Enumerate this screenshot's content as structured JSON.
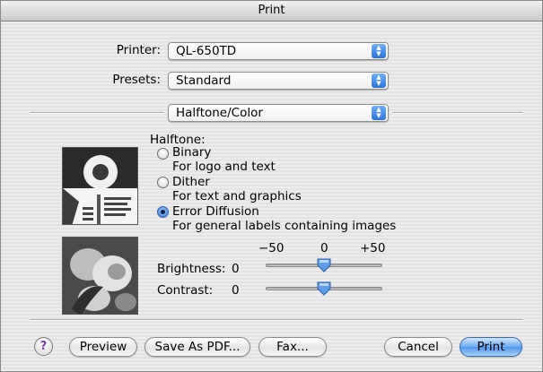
{
  "window": {
    "title": "Print"
  },
  "printer": {
    "label": "Printer:",
    "value": "QL-650TD"
  },
  "presets": {
    "label": "Presets:",
    "value": "Standard"
  },
  "panel": {
    "value": "Halftone/Color"
  },
  "halftone": {
    "heading": "Halftone:",
    "options": [
      {
        "label": "Binary",
        "description": "For logo and text",
        "selected": false
      },
      {
        "label": "Dither",
        "description": "For text and graphics",
        "selected": false
      },
      {
        "label": "Error Diffusion",
        "description": "For general labels containing images",
        "selected": true
      }
    ]
  },
  "scale": {
    "min": "−50",
    "mid": "0",
    "max": "+50"
  },
  "brightness": {
    "label": "Brightness:",
    "value": "0"
  },
  "contrast": {
    "label": "Contrast:",
    "value": "0"
  },
  "buttons": {
    "help": "?",
    "preview": "Preview",
    "save_pdf": "Save As PDF...",
    "fax": "Fax...",
    "cancel": "Cancel",
    "print": "Print"
  },
  "colors": {
    "accent": "#3b7fe0",
    "help_glyph": "#7b3fb0"
  },
  "icons": {
    "popup": "up-down-arrows-icon"
  }
}
